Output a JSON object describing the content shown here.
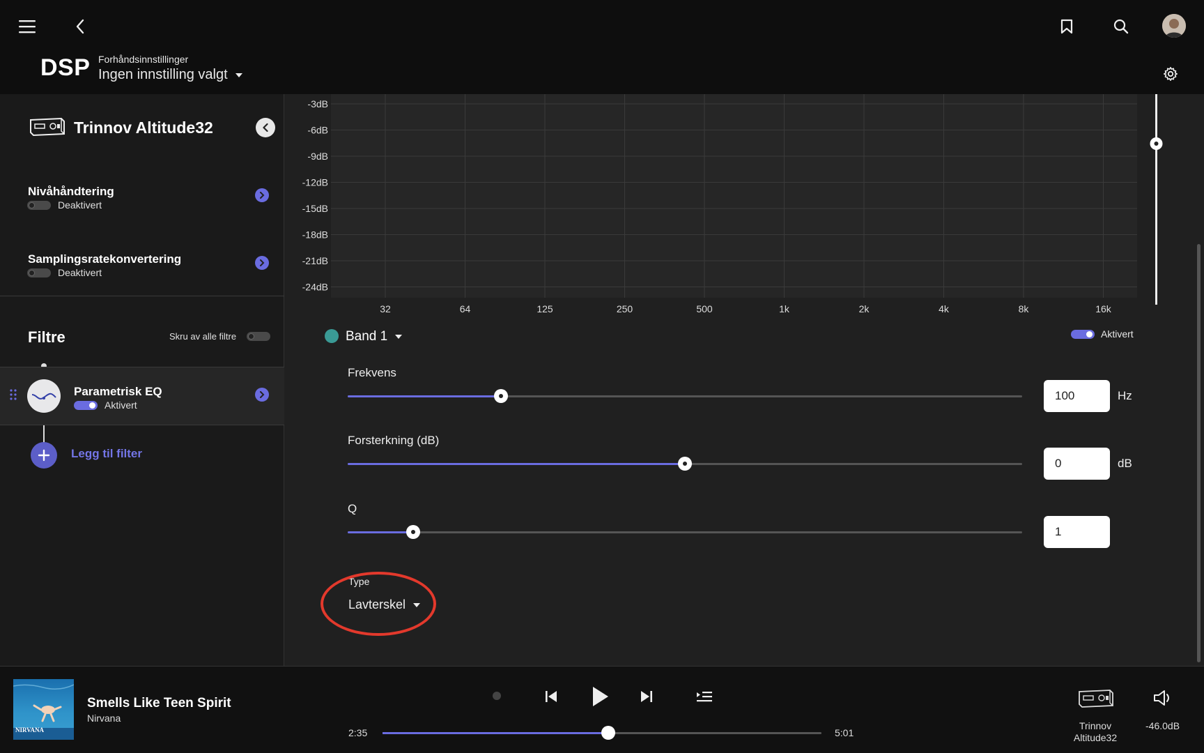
{
  "header": {
    "title": "DSP",
    "preset_label": "Forhåndsinnstillinger",
    "preset_value": "Ingen innstilling valgt"
  },
  "sidebar": {
    "device_name": "Trinnov Altitude32",
    "items": [
      {
        "title": "Nivåhåndtering",
        "status": "Deaktivert",
        "enabled": false
      },
      {
        "title": "Samplingsratekonvertering",
        "status": "Deaktivert",
        "enabled": false
      }
    ],
    "filters_title": "Filtre",
    "filters_all_label": "Skru av alle filtre",
    "filter": {
      "title": "Parametrisk EQ",
      "status": "Aktivert",
      "enabled": true
    },
    "add_filter_label": "Legg til filter"
  },
  "chart_data": {
    "type": "line",
    "y_ticks": [
      "-3dB",
      "-6dB",
      "-9dB",
      "-12dB",
      "-15dB",
      "-18dB",
      "-21dB",
      "-24dB"
    ],
    "x_ticks": [
      "32",
      "64",
      "125",
      "250",
      "500",
      "1k",
      "2k",
      "4k",
      "8k",
      "16k"
    ],
    "grid": true,
    "accent": "#6a6ce0"
  },
  "band": {
    "name": "Band 1",
    "color": "#3a9a95",
    "enabled_label": "Aktivert",
    "enabled": true
  },
  "params": {
    "frequency": {
      "label": "Frekvens",
      "value": "100",
      "unit": "Hz",
      "level": 0.227
    },
    "gain": {
      "label": "Forsterkning (dB)",
      "value": "0",
      "unit": "dB",
      "level": 0.5
    },
    "q": {
      "label": "Q",
      "value": "1",
      "level": 0.097
    },
    "type": {
      "label": "Type",
      "value": "Lavterskel"
    }
  },
  "player": {
    "title": "Smells Like Teen Spirit",
    "artist": "Nirvana",
    "album_text": "NIRVANA",
    "time_current": "2:35",
    "time_total": "5:01",
    "progress": 0.515,
    "output_name": "Trinnov Altitude32",
    "volume": "-46.0dB"
  }
}
